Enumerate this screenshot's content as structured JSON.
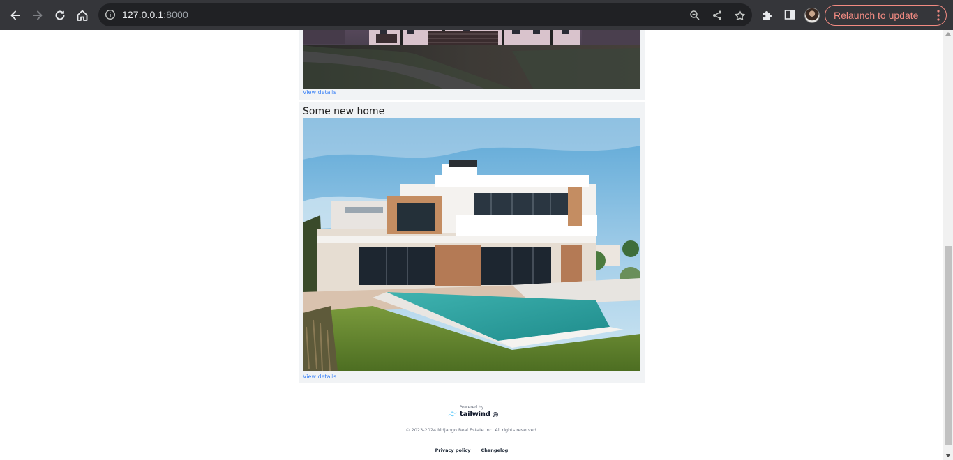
{
  "browser": {
    "url_host": "127.0.0.1",
    "url_port": ":8000",
    "relaunch_label": "Relaunch to update",
    "colors": {
      "toolbar": "#35363a",
      "omnibox": "#202124",
      "relaunch": "#f28b82"
    },
    "icons": [
      "back-icon",
      "forward-icon",
      "reload-icon",
      "home-icon",
      "info-icon",
      "zoom-icon",
      "share-icon",
      "star-icon",
      "extensions-icon",
      "side-panel-icon",
      "avatar",
      "menu-dots-icon"
    ]
  },
  "listings": [
    {
      "title": "",
      "link_label": "View details",
      "image": "house-dusk"
    },
    {
      "title": "Some new home",
      "link_label": "View details",
      "image": "modern-villa-pool"
    }
  ],
  "footer": {
    "powered_by": "Powered by",
    "brand": "tailwind",
    "copyright": "© 2023-2024 Mdjango Real Estate Inc. All rights reserved.",
    "links": [
      "Privacy policy",
      "Changelog"
    ]
  }
}
